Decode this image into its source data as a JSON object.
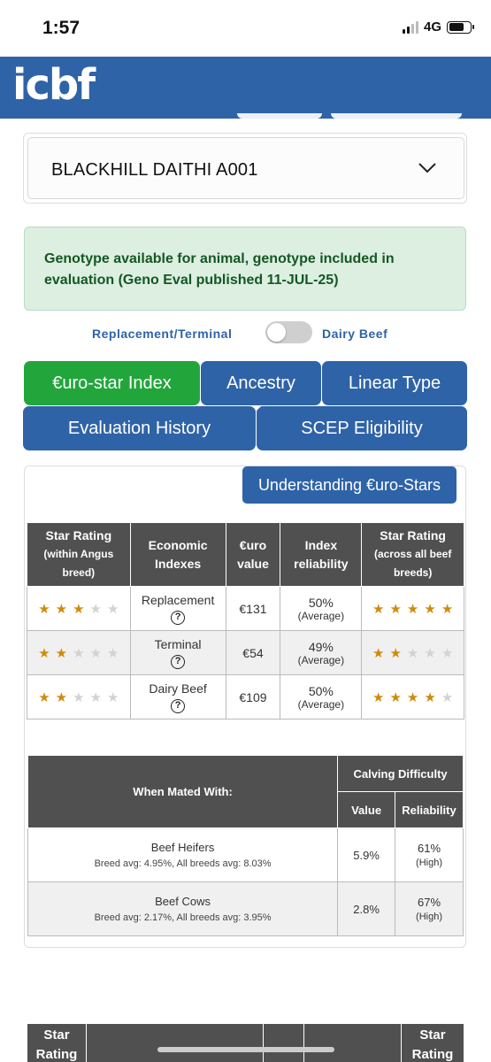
{
  "status": {
    "time": "1:57",
    "network": "4G"
  },
  "header": {
    "logo": "icbf"
  },
  "animal": {
    "name": "BLACKHILL DAITHI A001"
  },
  "genotype_alert": "Genotype available for animal, genotype included in evaluation (Geno Eval published 11-JUL-25)",
  "toggle": {
    "left": "Replacement/Terminal",
    "right": "Dairy Beef"
  },
  "tabs": {
    "eurostar": "€uro-star Index",
    "ancestry": "Ancestry",
    "linear": "Linear Type",
    "history": "Evaluation History",
    "scep": "SCEP Eligibility"
  },
  "understand_button": "Understanding €uro-Stars",
  "stars_table": {
    "headers": {
      "star_within": "Star Rating",
      "star_within_sub": "(within Angus breed)",
      "economic": "Economic Indexes",
      "euro": "€uro value",
      "reliability": "Index reliability",
      "star_across": "Star Rating",
      "star_across_sub": "(across all beef breeds)"
    },
    "rows": [
      {
        "index": "Replacement",
        "value": "€131",
        "reliability": "50%",
        "reliability_label": "(Average)",
        "stars_within": 3,
        "stars_across": 5
      },
      {
        "index": "Terminal",
        "value": "€54",
        "reliability": "49%",
        "reliability_label": "(Average)",
        "stars_within": 2,
        "stars_across": 2
      },
      {
        "index": "Dairy Beef",
        "value": "€109",
        "reliability": "50%",
        "reliability_label": "(Average)",
        "stars_within": 2,
        "stars_across": 4
      }
    ],
    "help_symbol": "?"
  },
  "calving_table": {
    "header_mated": "When Mated With:",
    "header_group": "Calving Difficulty",
    "header_value": "Value",
    "header_reliability": "Reliability",
    "rows": [
      {
        "group": "Beef Heifers",
        "avg": "Breed avg: 4.95%, All breeds avg: 8.03%",
        "value": "5.9%",
        "reliability": "61%",
        "reliability_label": "(High)"
      },
      {
        "group": "Beef Cows",
        "avg": "Breed avg: 2.17%, All breeds avg: 3.95%",
        "value": "2.8%",
        "reliability": "67%",
        "reliability_label": "(High)"
      }
    ]
  },
  "bottom_table": {
    "left_header": "Star Rating",
    "right_header": "Star Rating"
  },
  "colors": {
    "brand_blue": "#2f63a7",
    "active_tab_green": "#22a63c",
    "alert_bg": "#dcefe1",
    "star_gold": "#d08a0a",
    "table_header": "#505050"
  }
}
